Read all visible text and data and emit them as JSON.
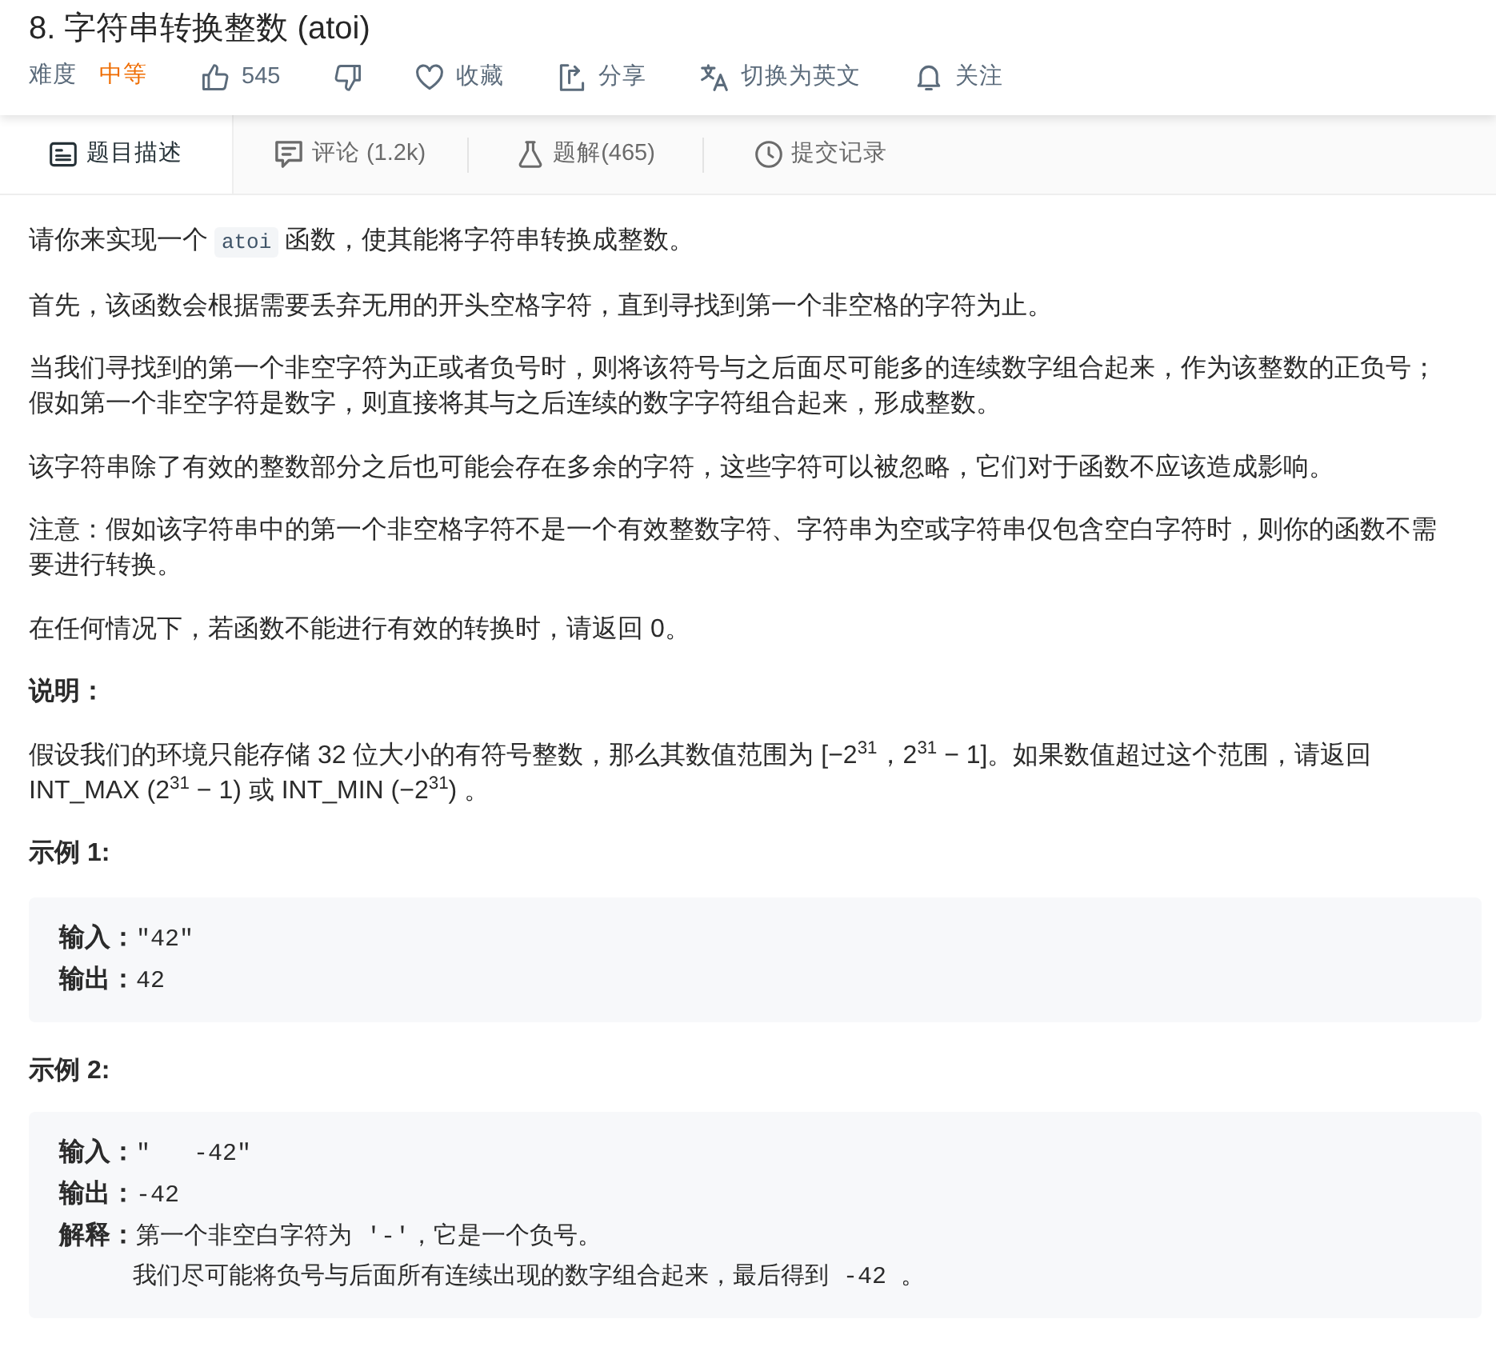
{
  "problem": {
    "title": "8. 字符串转换整数 (atoi)",
    "difficulty_label": "难度",
    "difficulty": "中等"
  },
  "actions": [
    {
      "kind": "like",
      "label": "545"
    },
    {
      "kind": "dislike"
    },
    {
      "kind": "favorite",
      "label": "收藏"
    },
    {
      "kind": "share",
      "label": "分享"
    },
    {
      "kind": "translate",
      "label": "切换为英文"
    },
    {
      "kind": "follow",
      "label": "关注"
    }
  ],
  "tabs": [
    {
      "kind": "description",
      "label": "题目描述",
      "selected": true
    },
    {
      "kind": "comments",
      "label": "评论 (1.2k)",
      "selected": false
    },
    {
      "kind": "solutions",
      "label": "题解(465)",
      "selected": false
    },
    {
      "kind": "submissions",
      "label": "提交记录",
      "selected": false
    }
  ],
  "content": [
    {
      "kind": "paragraph",
      "segments": [
        {
          "kind": "text",
          "text": "请你来实现一个 "
        },
        {
          "kind": "code",
          "text": "atoi"
        },
        {
          "kind": "text",
          "text": " 函数，使其能将字符串转换成整数。"
        }
      ]
    },
    {
      "kind": "paragraph",
      "segments": [
        {
          "kind": "text",
          "text": "首先，该函数会根据需要丢弃无用的开头空格字符，直到寻找到第一个非空格的字符为止。"
        }
      ]
    },
    {
      "kind": "paragraph",
      "segments": [
        {
          "kind": "text",
          "text": "当我们寻找到的第一个非空字符为正或者负号时，则将该符号与之后面尽可能多的连续数字组合起来，作为该整数的正负号；"
        },
        {
          "kind": "break"
        },
        {
          "kind": "text",
          "text": "假如第一个非空字符是数字，则直接将其与之后连续的数字字符组合起来，形成整数。"
        }
      ]
    },
    {
      "kind": "paragraph",
      "segments": [
        {
          "kind": "text",
          "text": "该字符串除了有效的整数部分之后也可能会存在多余的字符，这些字符可以被忽略，它们对于函数不应该造成影响。"
        }
      ]
    },
    {
      "kind": "paragraph",
      "segments": [
        {
          "kind": "text",
          "text": "注意：假如该字符串中的第一个非空格字符不是一个有效整数字符、字符串为空或字符串仅包含空白字符时，则你的函数不需要进行转换。"
        }
      ]
    },
    {
      "kind": "paragraph",
      "segments": [
        {
          "kind": "text",
          "text": "在任何情况下，若函数不能进行有效的转换时，请返回 0。"
        }
      ]
    },
    {
      "kind": "heading",
      "text": "说明："
    },
    {
      "kind": "paragraph",
      "segments": [
        {
          "kind": "text",
          "text": "假设我们的环境只能存储 32 位大小的有符号整数，那么其数值范围为 [−2$^{31}$，2$^{31}$ − 1]。如果数值超过这个范围，请返回"
        },
        {
          "kind": "break"
        },
        {
          "kind": "text",
          "text": "INT_MAX (2$^{31}$ − 1) 或 INT_MIN (−2$^{31}$) 。"
        }
      ]
    },
    {
      "kind": "heading",
      "text": "示例 1:"
    },
    {
      "kind": "example",
      "lines": [
        {
          "label": "输入：",
          "text": "\"42\""
        },
        {
          "label": "输出：",
          "text": "42"
        }
      ]
    },
    {
      "kind": "heading",
      "text": "示例 2:"
    },
    {
      "kind": "example",
      "lines": [
        {
          "label": "输入：",
          "text": "\"   -42\""
        },
        {
          "label": "输出：",
          "text": "-42"
        },
        {
          "label": "解释：",
          "text": "第一个非空白字符为 '-'，它是一个负号。"
        },
        {
          "text": "我们尽可能将负号与后面所有连续出现的数字组合起来，最后得到 -42 。"
        }
      ]
    }
  ]
}
